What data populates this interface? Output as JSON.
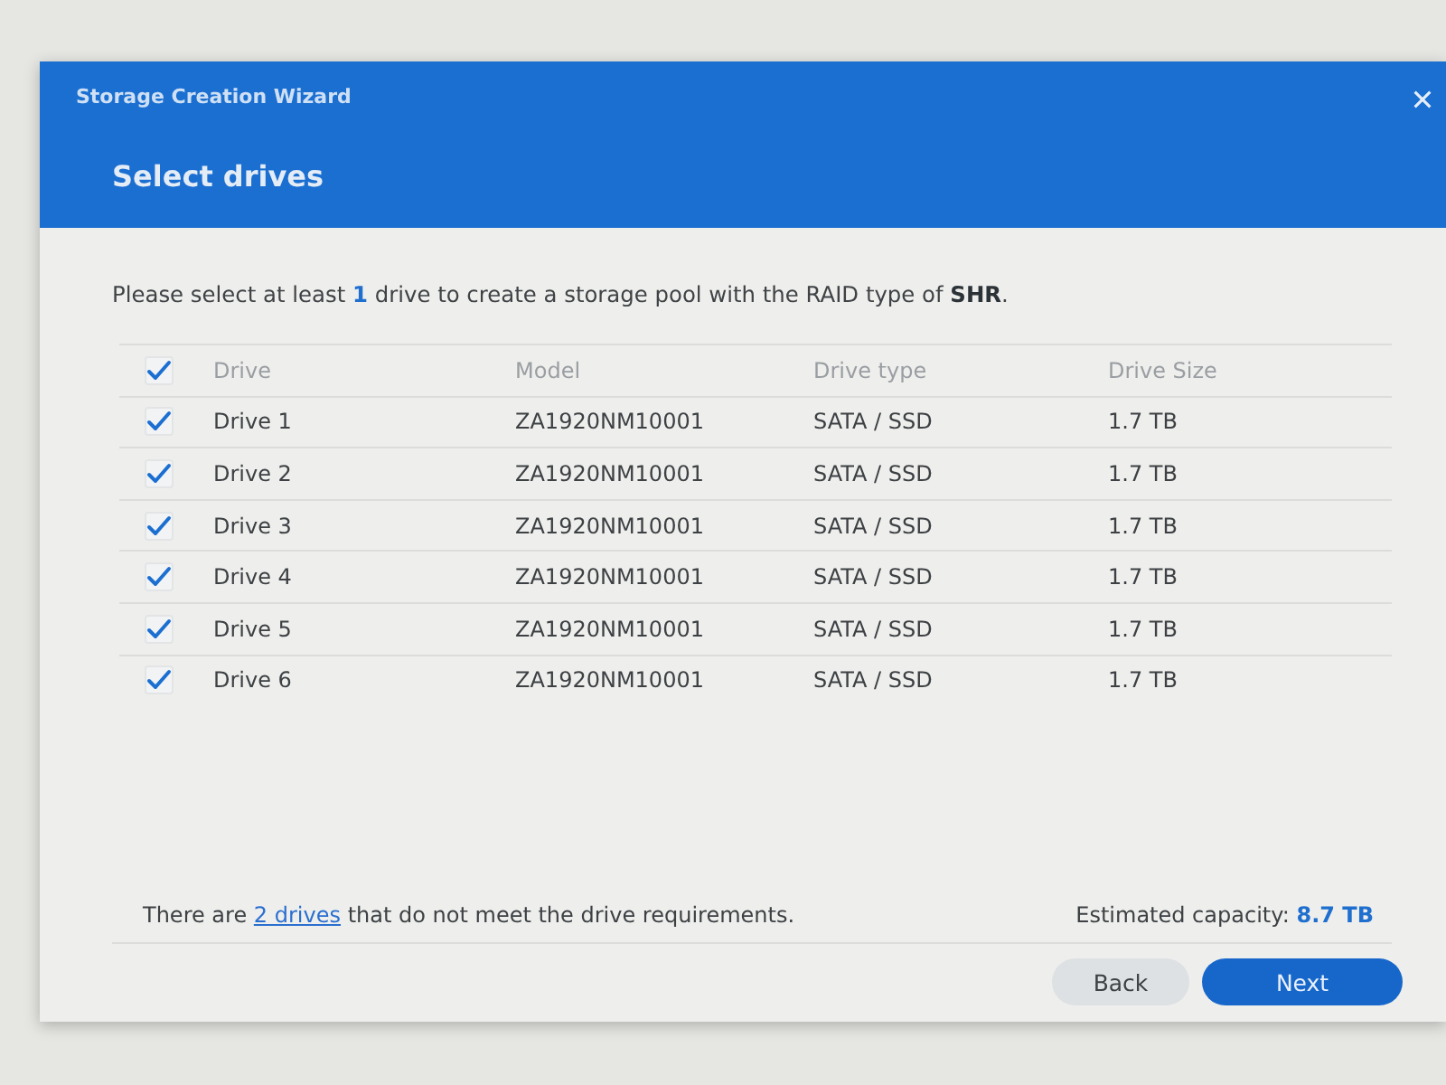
{
  "window": {
    "title": "Storage Creation Wizard"
  },
  "step_title": "Select drives",
  "instruction": "Please select at least **1** drive to create a storage pool with the RAID type of **SHR**.",
  "table": {
    "select_all_checked": true,
    "columns": [
      "Drive",
      "Model",
      "Drive type",
      "Drive Size"
    ],
    "rows": [
      {
        "checked": true,
        "cells": [
          "Drive 1",
          "ZA1920NM10001",
          "SATA / SSD",
          "1.7 TB"
        ]
      },
      {
        "checked": true,
        "cells": [
          "Drive 2",
          "ZA1920NM10001",
          "SATA / SSD",
          "1.7 TB"
        ]
      },
      {
        "checked": true,
        "cells": [
          "Drive 3",
          "ZA1920NM10001",
          "SATA / SSD",
          "1.7 TB"
        ]
      },
      {
        "checked": true,
        "cells": [
          "Drive 4",
          "ZA1920NM10001",
          "SATA / SSD",
          "1.7 TB"
        ]
      },
      {
        "checked": true,
        "cells": [
          "Drive 5",
          "ZA1920NM10001",
          "SATA / SSD",
          "1.7 TB"
        ]
      },
      {
        "checked": true,
        "cells": [
          "Drive 6",
          "ZA1920NM10001",
          "SATA / SSD",
          "1.7 TB"
        ]
      }
    ]
  },
  "notice": {
    "before": "There are",
    "link": "2 drives",
    "after": "that do not meet the drive requirements."
  },
  "capacity": "Estimated capacity: **8.7 TB**",
  "buttons": [
    {
      "label": "Back",
      "kind": "secondary"
    },
    {
      "label": "Next",
      "kind": "primary"
    }
  ]
}
